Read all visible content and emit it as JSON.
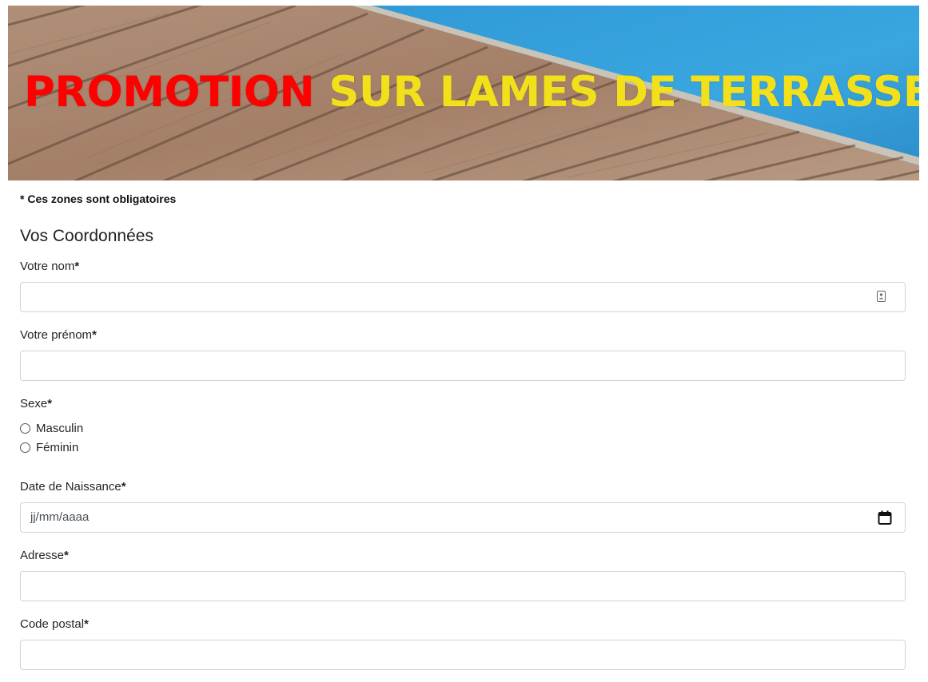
{
  "banner": {
    "title_red": "PROMOTION",
    "title_yellow": "SUR LAMES DE TERRASSE",
    "red_color": "#ff0000",
    "yellow_color": "#f2e01a"
  },
  "form": {
    "required_note": "* Ces zones sont obligatoires",
    "section_title": "Vos Coordonnées",
    "fields": {
      "nom": {
        "label": "Votre nom",
        "value": "",
        "placeholder": ""
      },
      "prenom": {
        "label": "Votre prénom",
        "value": "",
        "placeholder": ""
      },
      "sexe": {
        "label": "Sexe",
        "options": [
          "Masculin",
          "Féminin"
        ],
        "selected": null
      },
      "naissance": {
        "label": "Date de Naissance",
        "placeholder": "jj/mm/aaaa"
      },
      "adresse": {
        "label": "Adresse",
        "value": "",
        "placeholder": ""
      },
      "code_postal": {
        "label": "Code postal",
        "value": "",
        "placeholder": ""
      }
    },
    "required_mark": "*"
  },
  "icons": {
    "nom_field_icon": "contact-card-icon",
    "date_field_icon": "calendar-icon"
  }
}
